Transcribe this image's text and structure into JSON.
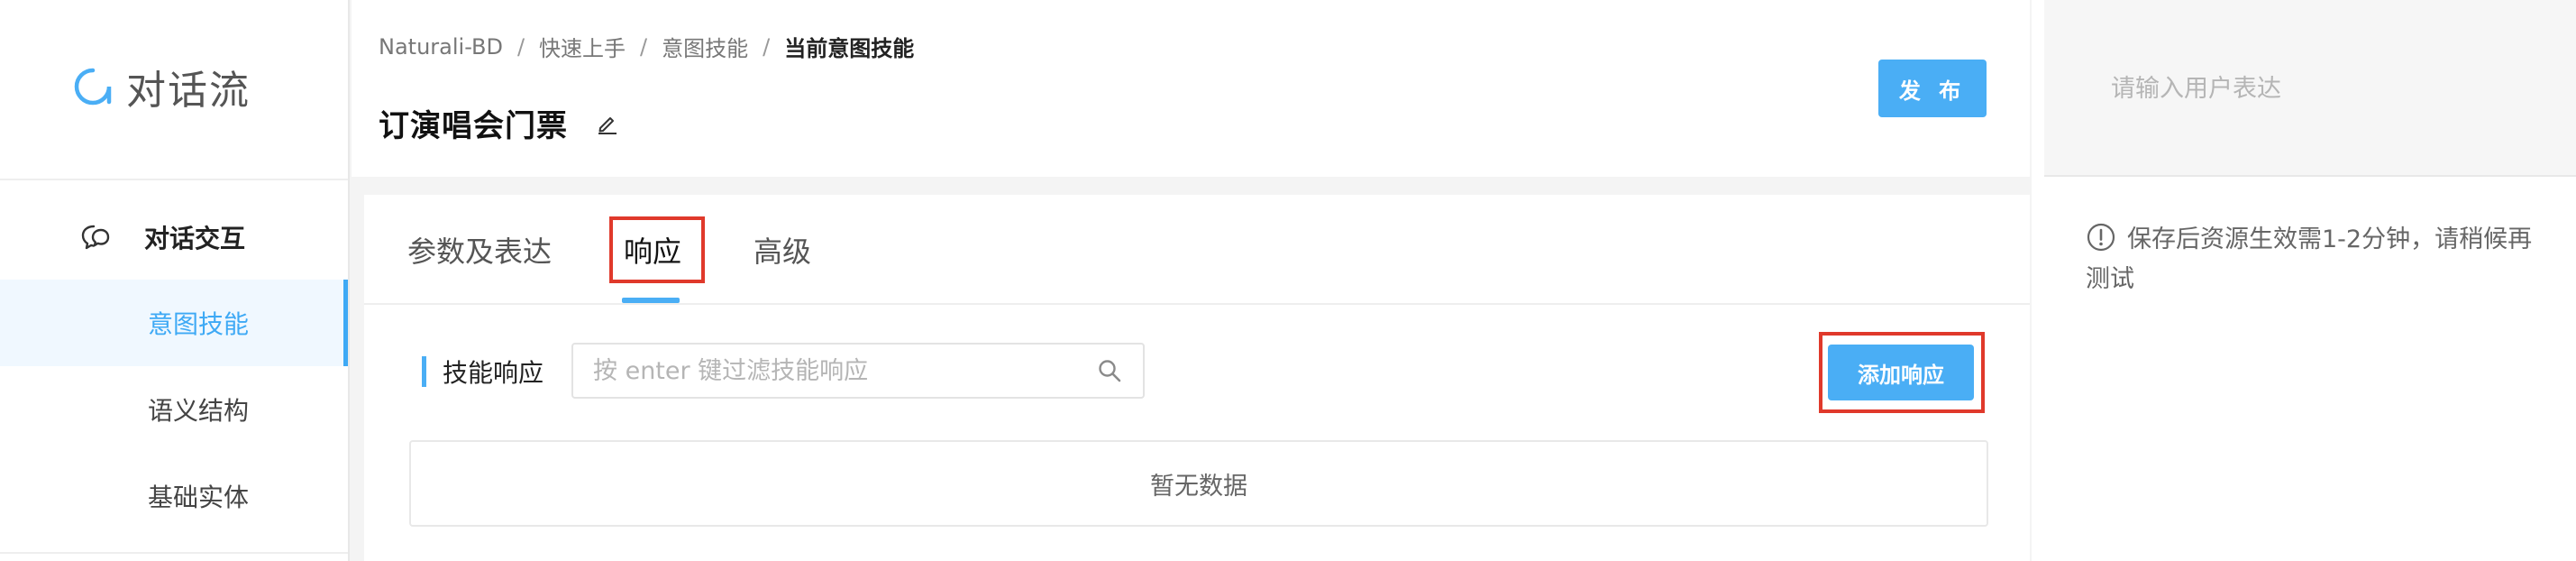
{
  "app": {
    "logo_text": "对话流"
  },
  "sidebar": {
    "group_label": "对话交互",
    "items": [
      {
        "label": "意图技能",
        "active": true
      },
      {
        "label": "语义结构",
        "active": false
      },
      {
        "label": "基础实体",
        "active": false
      }
    ]
  },
  "header": {
    "breadcrumb": [
      "Naturali-BD",
      "快速上手",
      "意图技能",
      "当前意图技能"
    ],
    "breadcrumb_sep": "/",
    "title": "订演唱会门票",
    "publish_label": "发 布"
  },
  "tabs": [
    {
      "label": "参数及表达",
      "active": false
    },
    {
      "label": "响应",
      "active": true
    },
    {
      "label": "高级",
      "active": false
    }
  ],
  "responses": {
    "section_label": "技能响应",
    "filter_placeholder": "按 enter 键过滤技能响应",
    "add_label": "添加响应",
    "empty_text": "暂无数据"
  },
  "test_panel": {
    "input_placeholder": "请输入用户表达",
    "notice": "保存后资源生效需1-2分钟，请稍候再测试"
  },
  "colors": {
    "accent": "#4aaef5",
    "highlight_border": "#e0392b",
    "active_nav_bg": "#f0f8ff"
  }
}
